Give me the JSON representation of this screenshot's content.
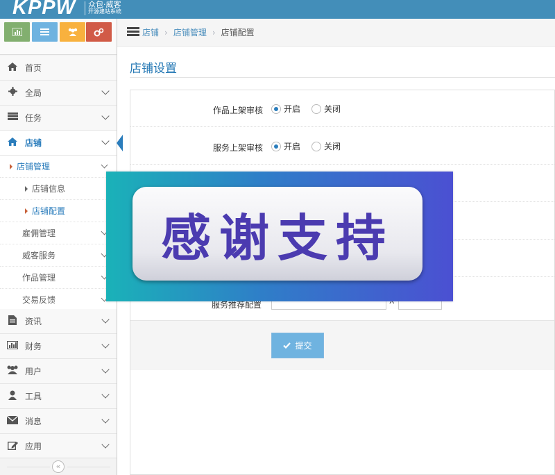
{
  "header": {
    "logo_text": "KPPW",
    "logo_sub1": "众包·威客",
    "logo_sub2": "开源建站系统"
  },
  "shortcuts": [
    {
      "icon": "bar-chart-icon",
      "color": "#82af6f"
    },
    {
      "icon": "list-icon",
      "color": "#6fb3e0"
    },
    {
      "icon": "users-icon",
      "color": "#f8b13e"
    },
    {
      "icon": "cogs-icon",
      "color": "#d15b47"
    }
  ],
  "sidebar": {
    "items": [
      {
        "label": "首页",
        "icon": "home-icon"
      },
      {
        "label": "全局",
        "icon": "gear-icon"
      },
      {
        "label": "任务",
        "icon": "list-icon"
      },
      {
        "label": "店铺",
        "icon": "home-icon",
        "active": true
      },
      {
        "label": "资讯",
        "icon": "document-icon"
      },
      {
        "label": "财务",
        "icon": "bar-chart-icon"
      },
      {
        "label": "用户",
        "icon": "users-icon"
      },
      {
        "label": "工具",
        "icon": "user-icon"
      },
      {
        "label": "消息",
        "icon": "envelope-icon"
      },
      {
        "label": "应用",
        "icon": "edit-icon"
      }
    ],
    "shop_sub": [
      {
        "label": "店铺管理",
        "expanded": true
      },
      {
        "label": "店铺信息"
      },
      {
        "label": "店铺配置",
        "active": true
      },
      {
        "label": "雇佣管理"
      },
      {
        "label": "威客服务"
      },
      {
        "label": "作品管理"
      },
      {
        "label": "交易反馈"
      }
    ],
    "collapse_glyph": "«"
  },
  "breadcrumb": {
    "items": [
      "店铺",
      "店铺管理"
    ],
    "current": "店铺配置",
    "separator": "›"
  },
  "page": {
    "title": "店铺设置"
  },
  "form": {
    "rows": [
      {
        "label": "作品上架审核",
        "options": [
          "开启",
          "关闭"
        ],
        "selected": "开启"
      },
      {
        "label": "服务上架审核",
        "options": [
          "开启",
          "关闭"
        ],
        "selected": "开启"
      }
    ],
    "partial_label": "服务推荐配置",
    "partial_x": "X",
    "submit_label": "提交",
    "submit_icon": "check-icon"
  },
  "overlay": {
    "text": "感谢支持"
  },
  "colors": {
    "topbar": "#438eb9",
    "accent": "#2b7dbc",
    "submit": "#6fb3e0"
  }
}
